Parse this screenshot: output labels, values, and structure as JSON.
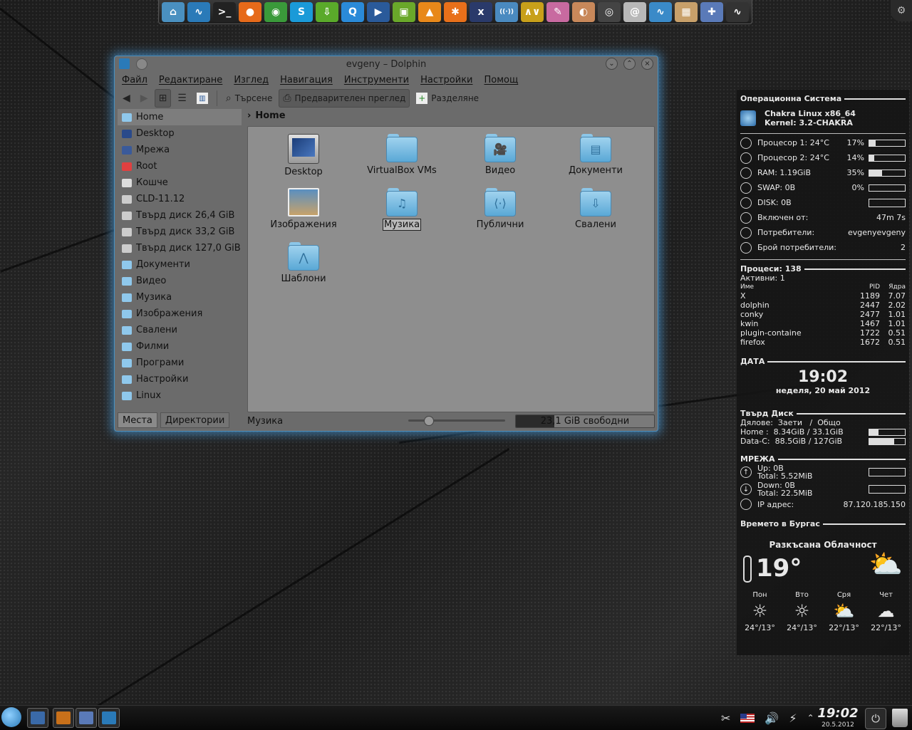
{
  "dock": {
    "icons": [
      {
        "name": "home-folder-icon",
        "color": "#4a90c0",
        "glyph": "⌂"
      },
      {
        "name": "dolphin-icon",
        "color": "#2a7ab8",
        "glyph": "∿"
      },
      {
        "name": "terminal-icon",
        "color": "#222222",
        "glyph": ">_"
      },
      {
        "name": "firefox-icon",
        "color": "#e66a1a",
        "glyph": "●"
      },
      {
        "name": "chrome-icon",
        "color": "#3a9a3a",
        "glyph": "◉"
      },
      {
        "name": "skype-icon",
        "color": "#1a9ad8",
        "glyph": "S"
      },
      {
        "name": "download-manager-icon",
        "color": "#5aaa2a",
        "glyph": "⇩"
      },
      {
        "name": "qbittorrent-icon",
        "color": "#2a8ad8",
        "glyph": "Q"
      },
      {
        "name": "video-player-icon",
        "color": "#2a5a9a",
        "glyph": "▶"
      },
      {
        "name": "video-editor-icon",
        "color": "#6aa82a",
        "glyph": "▣"
      },
      {
        "name": "vlc-icon",
        "color": "#e8881a",
        "glyph": "▲"
      },
      {
        "name": "burn-disc-icon",
        "color": "#e8701a",
        "glyph": "✱"
      },
      {
        "name": "xbmc-icon",
        "color": "#2a3a6a",
        "glyph": "x"
      },
      {
        "name": "network-icon",
        "color": "#4a8ac0",
        "glyph": "((·))"
      },
      {
        "name": "aiMP-icon",
        "color": "#c8a01a",
        "glyph": "∧∨"
      },
      {
        "name": "krita-icon",
        "color": "#c86aa0",
        "glyph": "✎"
      },
      {
        "name": "eye-icon",
        "color": "#c8885a",
        "glyph": "◐"
      },
      {
        "name": "camera-icon",
        "color": "#444444",
        "glyph": "◎"
      },
      {
        "name": "swirl-icon",
        "color": "#b8b8b8",
        "glyph": "@"
      },
      {
        "name": "system-monitor-icon",
        "color": "#3a8ac8",
        "glyph": "∿"
      },
      {
        "name": "package-installer-icon",
        "color": "#c8a06a",
        "glyph": "▦"
      },
      {
        "name": "settings-tools-icon",
        "color": "#5a7ab8",
        "glyph": "✚"
      },
      {
        "name": "ksysguard-icon",
        "color": "#333333",
        "glyph": "∿"
      }
    ]
  },
  "window": {
    "title": "evgeny – Dolphin",
    "menu": [
      "Файл",
      "Редактиране",
      "Изглед",
      "Навигация",
      "Инструменти",
      "Настройки",
      "Помощ"
    ],
    "toolbar": {
      "search": "Търсене",
      "preview": "Предварителен преглед",
      "split": "Разделяне"
    },
    "places": [
      {
        "label": "Home",
        "color": "#8fc8ec",
        "selected": true
      },
      {
        "label": "Desktop",
        "color": "#2a4a8a"
      },
      {
        "label": "Мрежа",
        "color": "#3a5a9a"
      },
      {
        "label": "Root",
        "color": "#e04040"
      },
      {
        "label": "Кошче",
        "color": "#dddddd"
      },
      {
        "label": "CLD-11.12",
        "color": "#cccccc"
      },
      {
        "label": "Твърд диск 26,4 GiB",
        "color": "#cccccc"
      },
      {
        "label": "Твърд диск 33,2 GiB",
        "color": "#cccccc"
      },
      {
        "label": "Твърд диск 127,0 GiB",
        "color": "#cccccc"
      },
      {
        "label": "Документи",
        "color": "#8fc8ec"
      },
      {
        "label": "Видео",
        "color": "#8fc8ec"
      },
      {
        "label": "Музика",
        "color": "#8fc8ec"
      },
      {
        "label": "Изображения",
        "color": "#8fc8ec"
      },
      {
        "label": "Свалени",
        "color": "#8fc8ec"
      },
      {
        "label": "Филми",
        "color": "#8fc8ec"
      },
      {
        "label": "Програми",
        "color": "#8fc8ec"
      },
      {
        "label": "Настройки",
        "color": "#8fc8ec"
      },
      {
        "label": "Linux",
        "color": "#8fc8ec"
      }
    ],
    "panel_tabs": [
      "Места",
      "Директории"
    ],
    "breadcrumb": "Home",
    "items": [
      {
        "label": "Desktop",
        "kind": "desktop"
      },
      {
        "label": "VirtualBox VMs",
        "kind": "folder",
        "emblem": ""
      },
      {
        "label": "Видео",
        "kind": "folder",
        "emblem": "🎥"
      },
      {
        "label": "Документи",
        "kind": "folder",
        "emblem": "▤"
      },
      {
        "label": "Изображения",
        "kind": "image"
      },
      {
        "label": "Музика",
        "kind": "folder",
        "emblem": "♫",
        "selected": true
      },
      {
        "label": "Публични",
        "kind": "folder",
        "emblem": "⟨·⟩"
      },
      {
        "label": "Свалени",
        "kind": "folder",
        "emblem": "⇩"
      },
      {
        "label": "Шаблони",
        "kind": "folder",
        "emblem": "⋀"
      }
    ],
    "status": "Музика",
    "zoom_fraction": 0.18,
    "free_space": "23,1 GiB свободни",
    "disk_used_fraction": 0.28
  },
  "conky": {
    "os_header": "Операционна Система",
    "distro": "Chakra Linux x86_64",
    "kernel": "Kernel: 3.2-CHAKRA",
    "stats": [
      {
        "label": "Процесор 1: 24°C",
        "value": "17%",
        "bar": 0.17,
        "icon": "cpu-icon"
      },
      {
        "label": "Процесор 2: 24°C",
        "value": "14%",
        "bar": 0.14,
        "icon": "cpu-icon"
      },
      {
        "label": "RAM: 1.19GiB",
        "value": "35%",
        "bar": 0.35,
        "icon": "ram-icon"
      },
      {
        "label": "SWAP: 0B",
        "value": "0%",
        "bar": 0,
        "icon": "swap-icon"
      },
      {
        "label": "DISK: 0B",
        "value": "",
        "graph": true,
        "icon": "disk-icon"
      },
      {
        "label": "Включен от:",
        "value": "47m 7s",
        "icon": "uptime-icon"
      },
      {
        "label": "Потребители:",
        "value": "evgenyevgeny",
        "icon": "users-icon"
      },
      {
        "label": "Брой потребители:",
        "value": "2",
        "icon": "user-count-icon"
      }
    ],
    "proc_header": "Процеси: 138",
    "proc_active": "Активни: 1",
    "proc_cols": {
      "name": "Име",
      "pid": "PID",
      "cpu": "Ядра"
    },
    "processes": [
      {
        "name": "X",
        "pid": "1189",
        "cpu": "7.07"
      },
      {
        "name": "dolphin",
        "pid": "2447",
        "cpu": "2.02"
      },
      {
        "name": "conky",
        "pid": "2477",
        "cpu": "1.01"
      },
      {
        "name": "kwin",
        "pid": "1467",
        "cpu": "1.01"
      },
      {
        "name": "plugin-containe",
        "pid": "1722",
        "cpu": "0.51"
      },
      {
        "name": "firefox",
        "pid": "1672",
        "cpu": "0.51"
      }
    ],
    "date_header": "ДАТА",
    "time": "19:02",
    "date": "неделя, 20 май 2012",
    "disk_header": "Твърд Диск",
    "disk_cols": "Дялове:  Заети   /  Общо",
    "disks": [
      {
        "label": "Home :  8.34GiB / 33.1GiB",
        "bar": 0.25
      },
      {
        "label": "Data-C:  88.5GiB / 127GiB",
        "bar": 0.7
      }
    ],
    "net_header": "МРЕЖА",
    "up": "Up: 0B",
    "up_total": "Total: 5.52MiB",
    "down": "Down: 0B",
    "down_total": "Total: 22.5MiB",
    "ip_label": "IP адрес:",
    "ip": "87.120.185.150",
    "weather_header": "Времето в Бургас",
    "condition": "Разкъсана Облачност",
    "temp": "19°",
    "forecast": [
      {
        "day": "Пон",
        "temps": "24°/13°",
        "icon": "sunny-icon"
      },
      {
        "day": "Вто",
        "temps": "24°/13°",
        "icon": "sunny-icon"
      },
      {
        "day": "Сря",
        "temps": "22°/13°",
        "icon": "partly-cloudy-icon"
      },
      {
        "day": "Чет",
        "temps": "22°/13°",
        "icon": "snow-icon"
      }
    ]
  },
  "taskbar": {
    "time": "19:02",
    "date": "20.5.2012",
    "tasks": [
      {
        "name": "task-desktop",
        "color": "#3a6aa8"
      },
      {
        "name": "task-kde-app",
        "color": "#c8701a"
      },
      {
        "name": "task-settings",
        "color": "#5a7ab8"
      },
      {
        "name": "task-dolphin",
        "color": "#2a7ab8"
      }
    ]
  }
}
